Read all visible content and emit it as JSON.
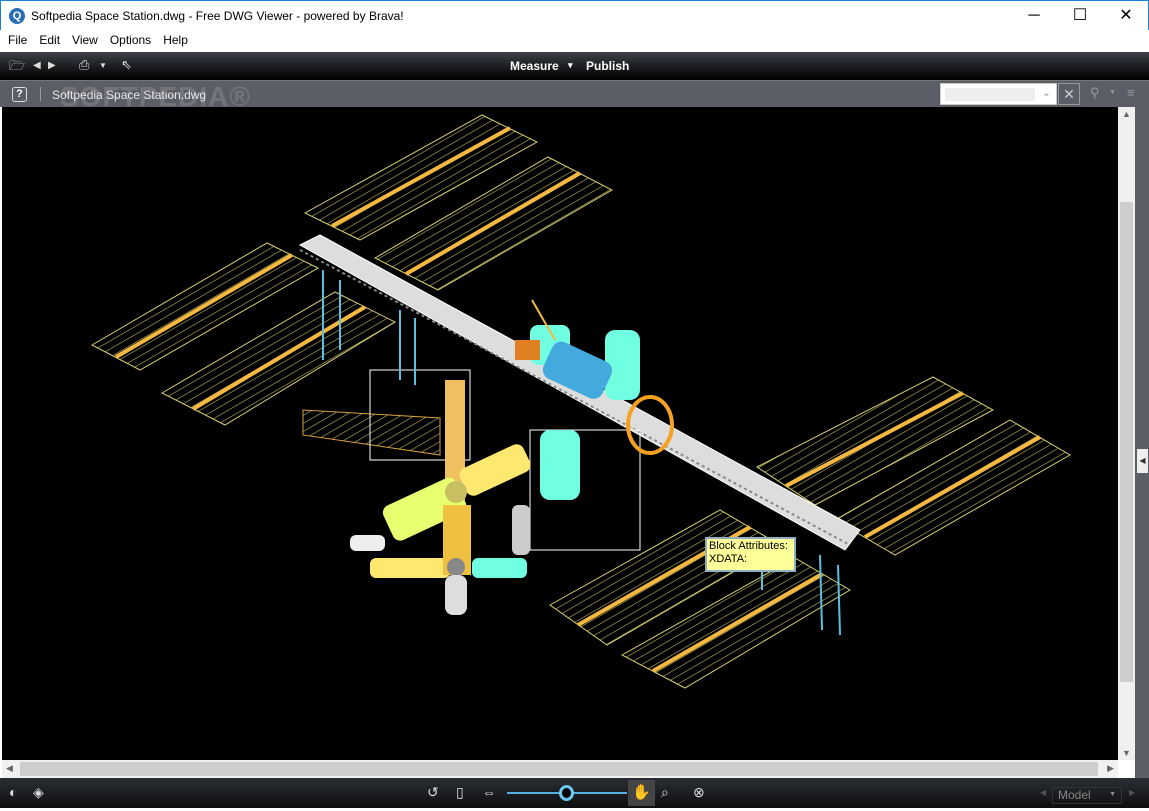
{
  "window": {
    "title": "Softpedia Space Station.dwg - Free DWG Viewer - powered by Brava!",
    "minimize": "─",
    "maximize": "☐",
    "close": "✕"
  },
  "menu": [
    "File",
    "Edit",
    "View",
    "Options",
    "Help"
  ],
  "toolbar": {
    "measure": "Measure",
    "measure_arrow": "▾",
    "publish": "Publish"
  },
  "docbar": {
    "help": "?",
    "doc_name": "Softpedia Space Station.dwg",
    "watermark": "SOFTPEDIA®",
    "search_value": ""
  },
  "tooltip": {
    "line1": "Block Attributes:",
    "line2": "XDATA:"
  },
  "bottom": {
    "layout": "Model",
    "zoom_fraction": 0.5
  },
  "colors": {
    "panel": "#c8c060",
    "strip": "#f5b840",
    "truss": "#ffffff",
    "module_cyan": "#70ffe0",
    "module_yellow": "#ffe870"
  }
}
